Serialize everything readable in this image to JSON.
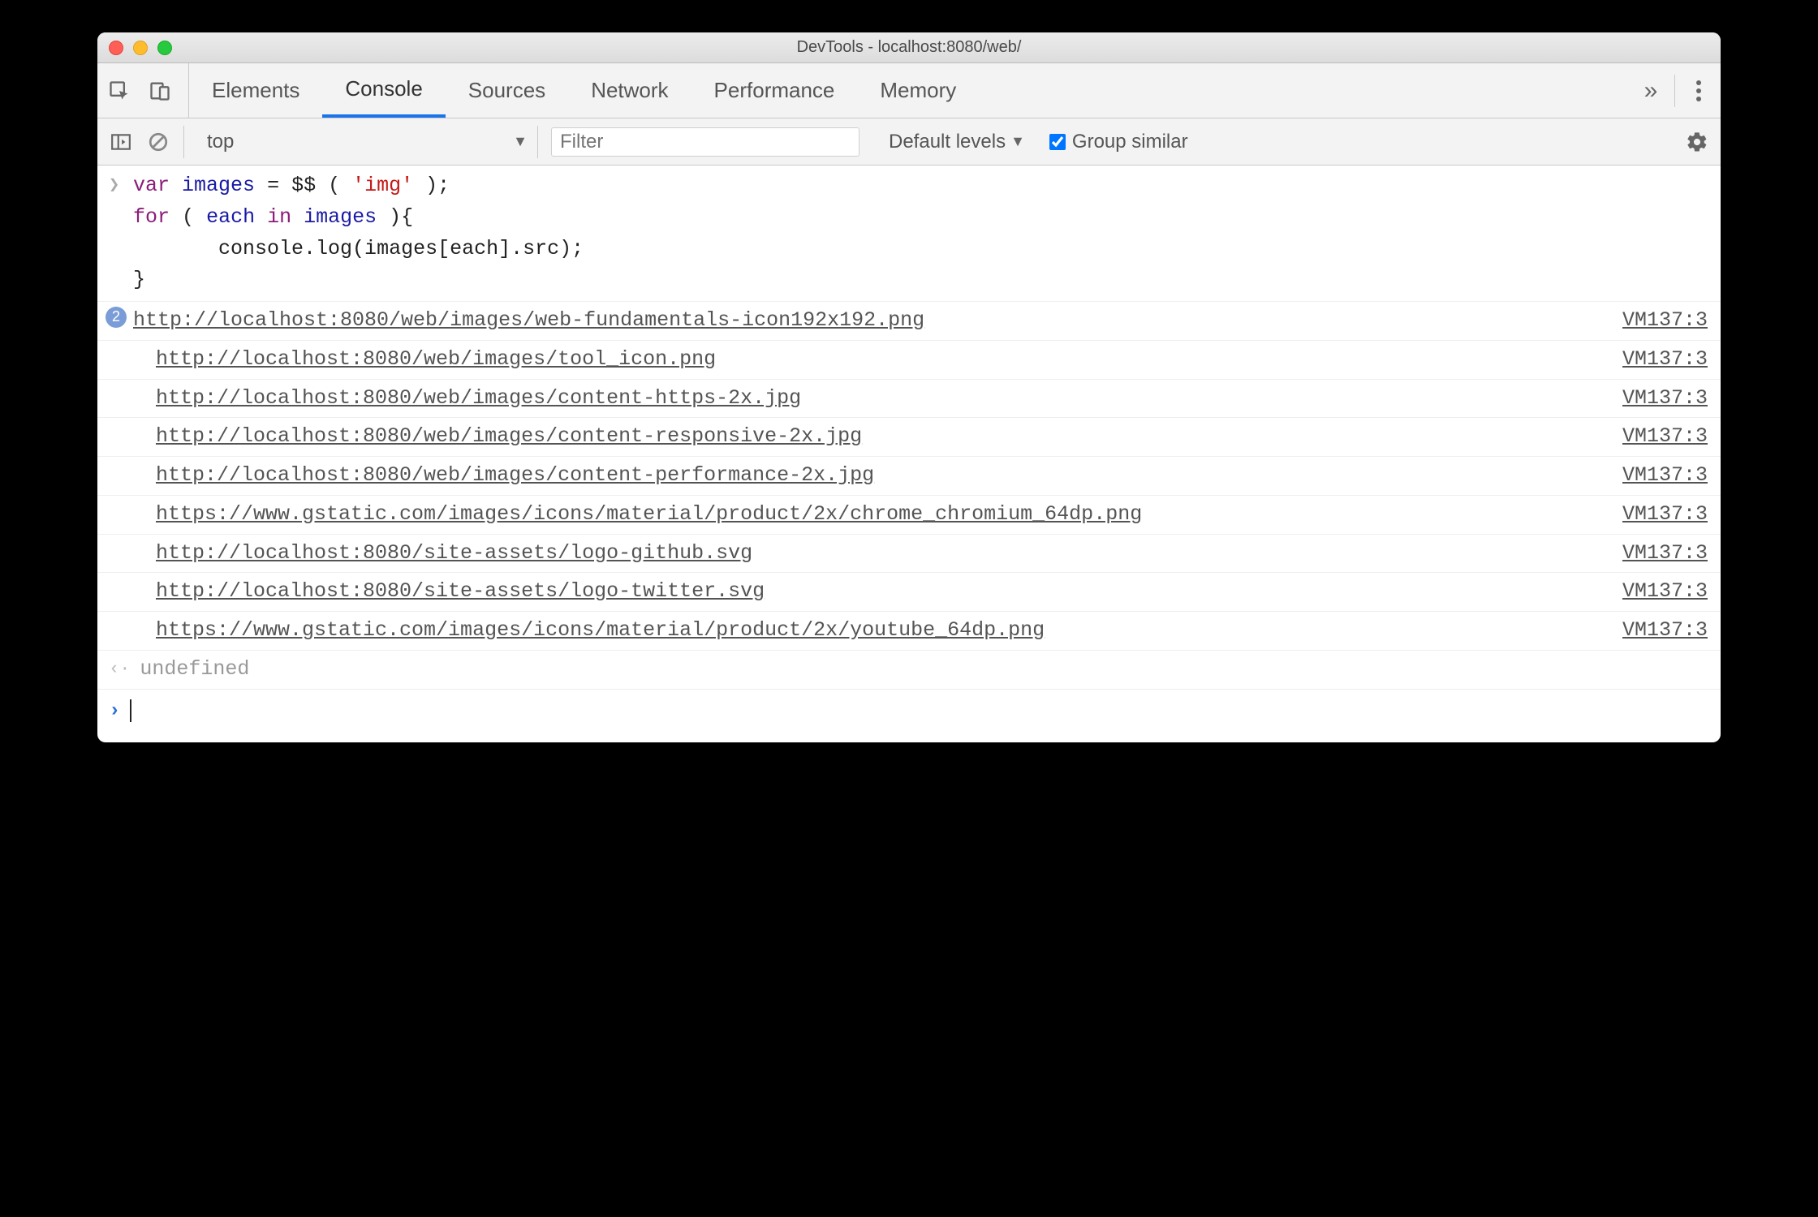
{
  "window": {
    "title": "DevTools - localhost:8080/web/"
  },
  "tabs": {
    "items": [
      "Elements",
      "Console",
      "Sources",
      "Network",
      "Performance",
      "Memory"
    ],
    "active": "Console"
  },
  "subbar": {
    "context": "top",
    "filter_placeholder": "Filter",
    "levels_label": "Default levels",
    "group_label": "Group similar",
    "group_checked": true
  },
  "console": {
    "input_code": {
      "l1": {
        "kw1": "var",
        "var1": "images",
        "eq": " = ",
        "fn": "$$",
        "open": "(",
        "str": "'img'",
        "close": ");"
      },
      "l2": {
        "kw1": "for",
        "open": " (",
        "var1": "each",
        "kw2": " in ",
        "var2": "images",
        "close": "){"
      },
      "l3": {
        "indent": "      ",
        "call": "console.log(images[each].src);"
      },
      "l4": {
        "text": "}"
      }
    },
    "logs": [
      {
        "count": 2,
        "url": "http://localhost:8080/web/images/web-fundamentals-icon192x192.png",
        "src": "VM137:3"
      },
      {
        "url": "http://localhost:8080/web/images/tool_icon.png",
        "src": "VM137:3"
      },
      {
        "url": "http://localhost:8080/web/images/content-https-2x.jpg",
        "src": "VM137:3"
      },
      {
        "url": "http://localhost:8080/web/images/content-responsive-2x.jpg",
        "src": "VM137:3"
      },
      {
        "url": "http://localhost:8080/web/images/content-performance-2x.jpg",
        "src": "VM137:3"
      },
      {
        "url": "https://www.gstatic.com/images/icons/material/product/2x/chrome_chromium_64dp.png",
        "src": "VM137:3"
      },
      {
        "url": "http://localhost:8080/site-assets/logo-github.svg",
        "src": "VM137:3"
      },
      {
        "url": "http://localhost:8080/site-assets/logo-twitter.svg",
        "src": "VM137:3"
      },
      {
        "url": "https://www.gstatic.com/images/icons/material/product/2x/youtube_64dp.png",
        "src": "VM137:3"
      }
    ],
    "return_value": "undefined"
  }
}
